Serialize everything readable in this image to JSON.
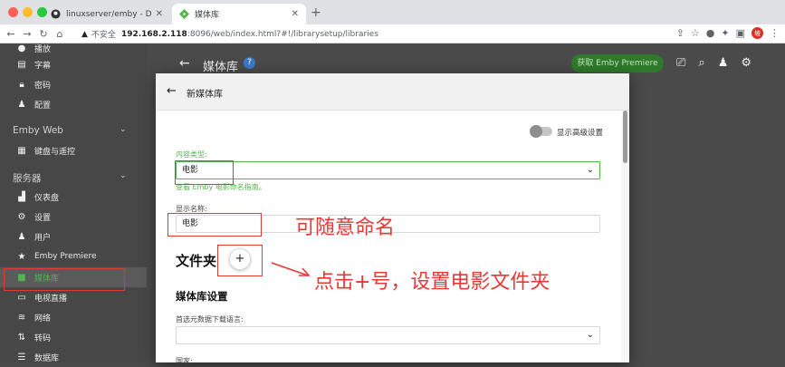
{
  "browser": {
    "tabs": [
      {
        "title": "linuxserver/emby - Docker Ima",
        "active": false
      },
      {
        "title": "媒体库",
        "active": true
      }
    ],
    "url": {
      "insecure_label": "不安全",
      "host": "192.168.2.118",
      "rest": ":8096/web/index.html?#!/librarysetup/libraries"
    },
    "profile_initial": "坡",
    "colors": {
      "close": "#ff5f57",
      "minimize": "#febc2e",
      "maximize": "#28c840"
    }
  },
  "sidebar": {
    "items_top": [
      {
        "icon": "play-icon",
        "label": "播放"
      },
      {
        "icon": "subtitles-icon",
        "label": "字幕"
      },
      {
        "icon": "lock-icon",
        "label": "密码"
      },
      {
        "icon": "person-icon",
        "label": "配置"
      }
    ],
    "section_web": "Emby Web",
    "items_web": [
      {
        "icon": "keyboard-icon",
        "label": "键盘与遥控"
      }
    ],
    "section_server": "服务器",
    "items_server": [
      {
        "icon": "dashboard-icon",
        "label": "仪表盘"
      },
      {
        "icon": "gear-icon",
        "label": "设置"
      },
      {
        "icon": "users-icon",
        "label": "用户"
      },
      {
        "icon": "star-icon",
        "label": "Emby Premiere"
      },
      {
        "icon": "folder-icon",
        "label": "媒体库",
        "selected": true
      },
      {
        "icon": "tv-icon",
        "label": "电视直播"
      },
      {
        "icon": "wifi-icon",
        "label": "网络"
      },
      {
        "icon": "transcode-icon",
        "label": "转码"
      },
      {
        "icon": "database-icon",
        "label": "数据库"
      }
    ]
  },
  "header": {
    "title": "媒体库",
    "help": "?",
    "premiere_button": "获取 Emby Premiere"
  },
  "modal": {
    "title": "新媒体库",
    "advanced_toggle_label": "显示高级设置",
    "content_type_label": "内容类型:",
    "content_type_value": "电影",
    "hint_text": "查看 Emby 电影命名指南。",
    "display_name_label": "显示名称:",
    "display_name_value": "电影",
    "folders_heading": "文件夹",
    "add_button": "+",
    "library_settings_heading": "媒体库设置",
    "metadata_lang_label": "首选元数据下载语言:",
    "country_label": "国家:"
  },
  "annotations": {
    "name_note": "可随意命名",
    "folder_note": "点击+号，设置电影文件夹",
    "color": "#e53935"
  },
  "accent_color": "#52b54b"
}
